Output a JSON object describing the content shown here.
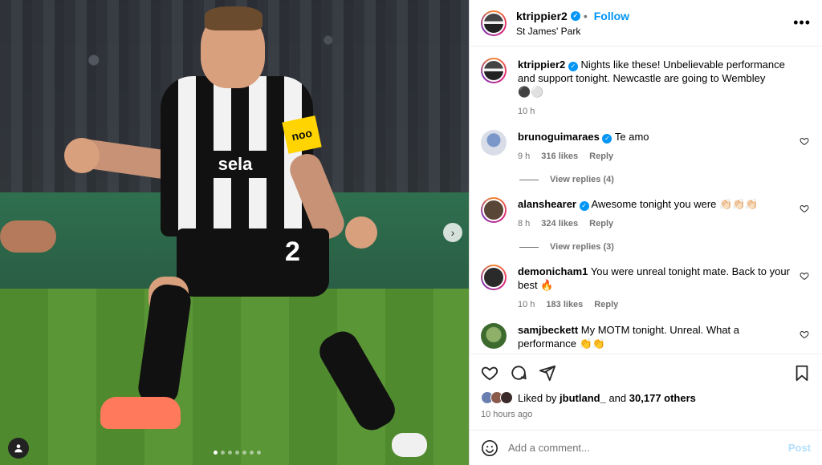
{
  "post": {
    "username": "ktrippier2",
    "follow_label": "Follow",
    "location": "St James' Park",
    "caption": "Nights like these! Unbelievable performance and support tonight. Newcastle are going to Wembley ⚫⚪",
    "caption_time": "10 h",
    "sponsor_text": "sela",
    "armband_text": "noo",
    "shirt_number": "2",
    "carousel_dots": 7,
    "carousel_active": 0
  },
  "comments": [
    {
      "username": "brunoguimaraes",
      "verified": true,
      "text": "Te amo",
      "time": "9 h",
      "likes": "316 likes",
      "reply": "Reply",
      "view_replies": "View replies (4)"
    },
    {
      "username": "alanshearer",
      "verified": true,
      "text": "Awesome tonight you were 👏🏻👏🏻👏🏻",
      "time": "8 h",
      "likes": "324 likes",
      "reply": "Reply",
      "view_replies": "View replies (3)"
    },
    {
      "username": "demonicham1",
      "verified": false,
      "text": "You were unreal tonight mate. Back to your best 🔥",
      "time": "10 h",
      "likes": "183 likes",
      "reply": "Reply",
      "view_replies": ""
    },
    {
      "username": "samjbeckett",
      "verified": false,
      "text": "My MOTM tonight. Unreal. What a performance 👏👏",
      "time": "",
      "likes": "",
      "reply": "",
      "view_replies": ""
    }
  ],
  "likes": {
    "prefix": "Liked by",
    "user": "jbutland_",
    "middle": "and",
    "others": "30,177 others"
  },
  "posted_ago": "10 hours ago",
  "add_comment": {
    "placeholder": "Add a comment...",
    "post_label": "Post"
  },
  "colors": {
    "accent": "#0095f6",
    "post_disabled": "#b2dffc",
    "muted": "#737373"
  },
  "icons": [
    "heart-icon",
    "comment-icon",
    "share-icon",
    "bookmark-icon",
    "emoji-icon",
    "more-icon",
    "tag-user-icon",
    "next-arrow-icon"
  ]
}
